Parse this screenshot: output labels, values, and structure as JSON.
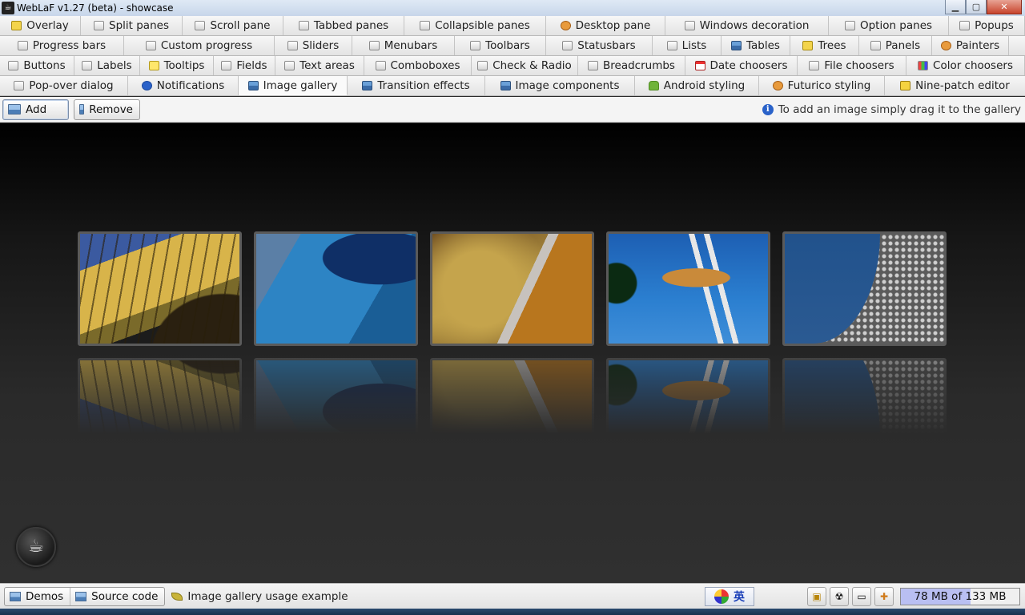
{
  "window": {
    "title": "WebLaF v1.27 (beta) - showcase",
    "controls": {
      "minimize": "▁",
      "maximize": "▢",
      "close": "✕"
    }
  },
  "tab_rows": [
    [
      {
        "label": "Overlay",
        "icon": "overlay-icon"
      },
      {
        "label": "Split panes",
        "icon": "split-icon"
      },
      {
        "label": "Scroll pane",
        "icon": "scroll-icon"
      },
      {
        "label": "Tabbed panes",
        "icon": "tab-icon"
      },
      {
        "label": "Collapsible panes",
        "icon": "collapse-icon"
      },
      {
        "label": "Desktop pane",
        "icon": "desktop-icon"
      },
      {
        "label": "Windows decoration",
        "icon": "window-icon"
      },
      {
        "label": "Option panes",
        "icon": "option-icon"
      },
      {
        "label": "Popups",
        "icon": "popup-icon"
      }
    ],
    [
      {
        "label": "Progress bars",
        "icon": "progress-icon"
      },
      {
        "label": "Custom progress",
        "icon": "custom-progress-icon"
      },
      {
        "label": "Sliders",
        "icon": "slider-icon"
      },
      {
        "label": "Menubars",
        "icon": "menubar-icon"
      },
      {
        "label": "Toolbars",
        "icon": "toolbar-icon"
      },
      {
        "label": "Statusbars",
        "icon": "statusbar-icon"
      },
      {
        "label": "Lists",
        "icon": "list-icon"
      },
      {
        "label": "Tables",
        "icon": "table-icon"
      },
      {
        "label": "Trees",
        "icon": "tree-icon"
      },
      {
        "label": "Panels",
        "icon": "panel-icon"
      },
      {
        "label": "Painters",
        "icon": "painter-icon"
      }
    ],
    [
      {
        "label": "Buttons",
        "icon": "button-icon"
      },
      {
        "label": "Labels",
        "icon": "label-icon"
      },
      {
        "label": "Tooltips",
        "icon": "tooltip-icon"
      },
      {
        "label": "Fields",
        "icon": "field-icon"
      },
      {
        "label": "Text areas",
        "icon": "textarea-icon"
      },
      {
        "label": "Comboboxes",
        "icon": "combobox-icon"
      },
      {
        "label": "Check & Radio",
        "icon": "checkbox-icon"
      },
      {
        "label": "Breadcrumbs",
        "icon": "breadcrumb-icon"
      },
      {
        "label": "Date choosers",
        "icon": "calendar-icon"
      },
      {
        "label": "File choosers",
        "icon": "file-icon"
      },
      {
        "label": "Color choosers",
        "icon": "color-icon"
      }
    ],
    [
      {
        "label": "Pop-over dialog",
        "icon": "popover-icon"
      },
      {
        "label": "Notifications",
        "icon": "info-icon"
      },
      {
        "label": "Image gallery",
        "icon": "image-icon",
        "selected": true
      },
      {
        "label": "Transition effects",
        "icon": "transition-icon"
      },
      {
        "label": "Image components",
        "icon": "image-components-icon"
      },
      {
        "label": "Android styling",
        "icon": "android-icon"
      },
      {
        "label": "Futurico styling",
        "icon": "futurico-icon"
      },
      {
        "label": "Nine-patch editor",
        "icon": "ninepatch-icon"
      }
    ]
  ],
  "toolbar": {
    "add_label": "Add",
    "remove_label": "Remove",
    "hint": "To add an image simply drag it to the gallery",
    "hint_icon": "i"
  },
  "gallery": {
    "images": [
      {
        "name": "gallery-image-canopy"
      },
      {
        "name": "gallery-image-blue-building"
      },
      {
        "name": "gallery-image-gold-facade"
      },
      {
        "name": "gallery-image-space-needle"
      },
      {
        "name": "gallery-image-disc-facade"
      }
    ]
  },
  "java_logo": "☕",
  "statusbar": {
    "crumbs": [
      "Demos",
      "Source code"
    ],
    "message": "Image gallery usage example",
    "ime_label": "英",
    "memory": "78 MB of 133 MB",
    "memory_used_fraction": 0.586
  }
}
